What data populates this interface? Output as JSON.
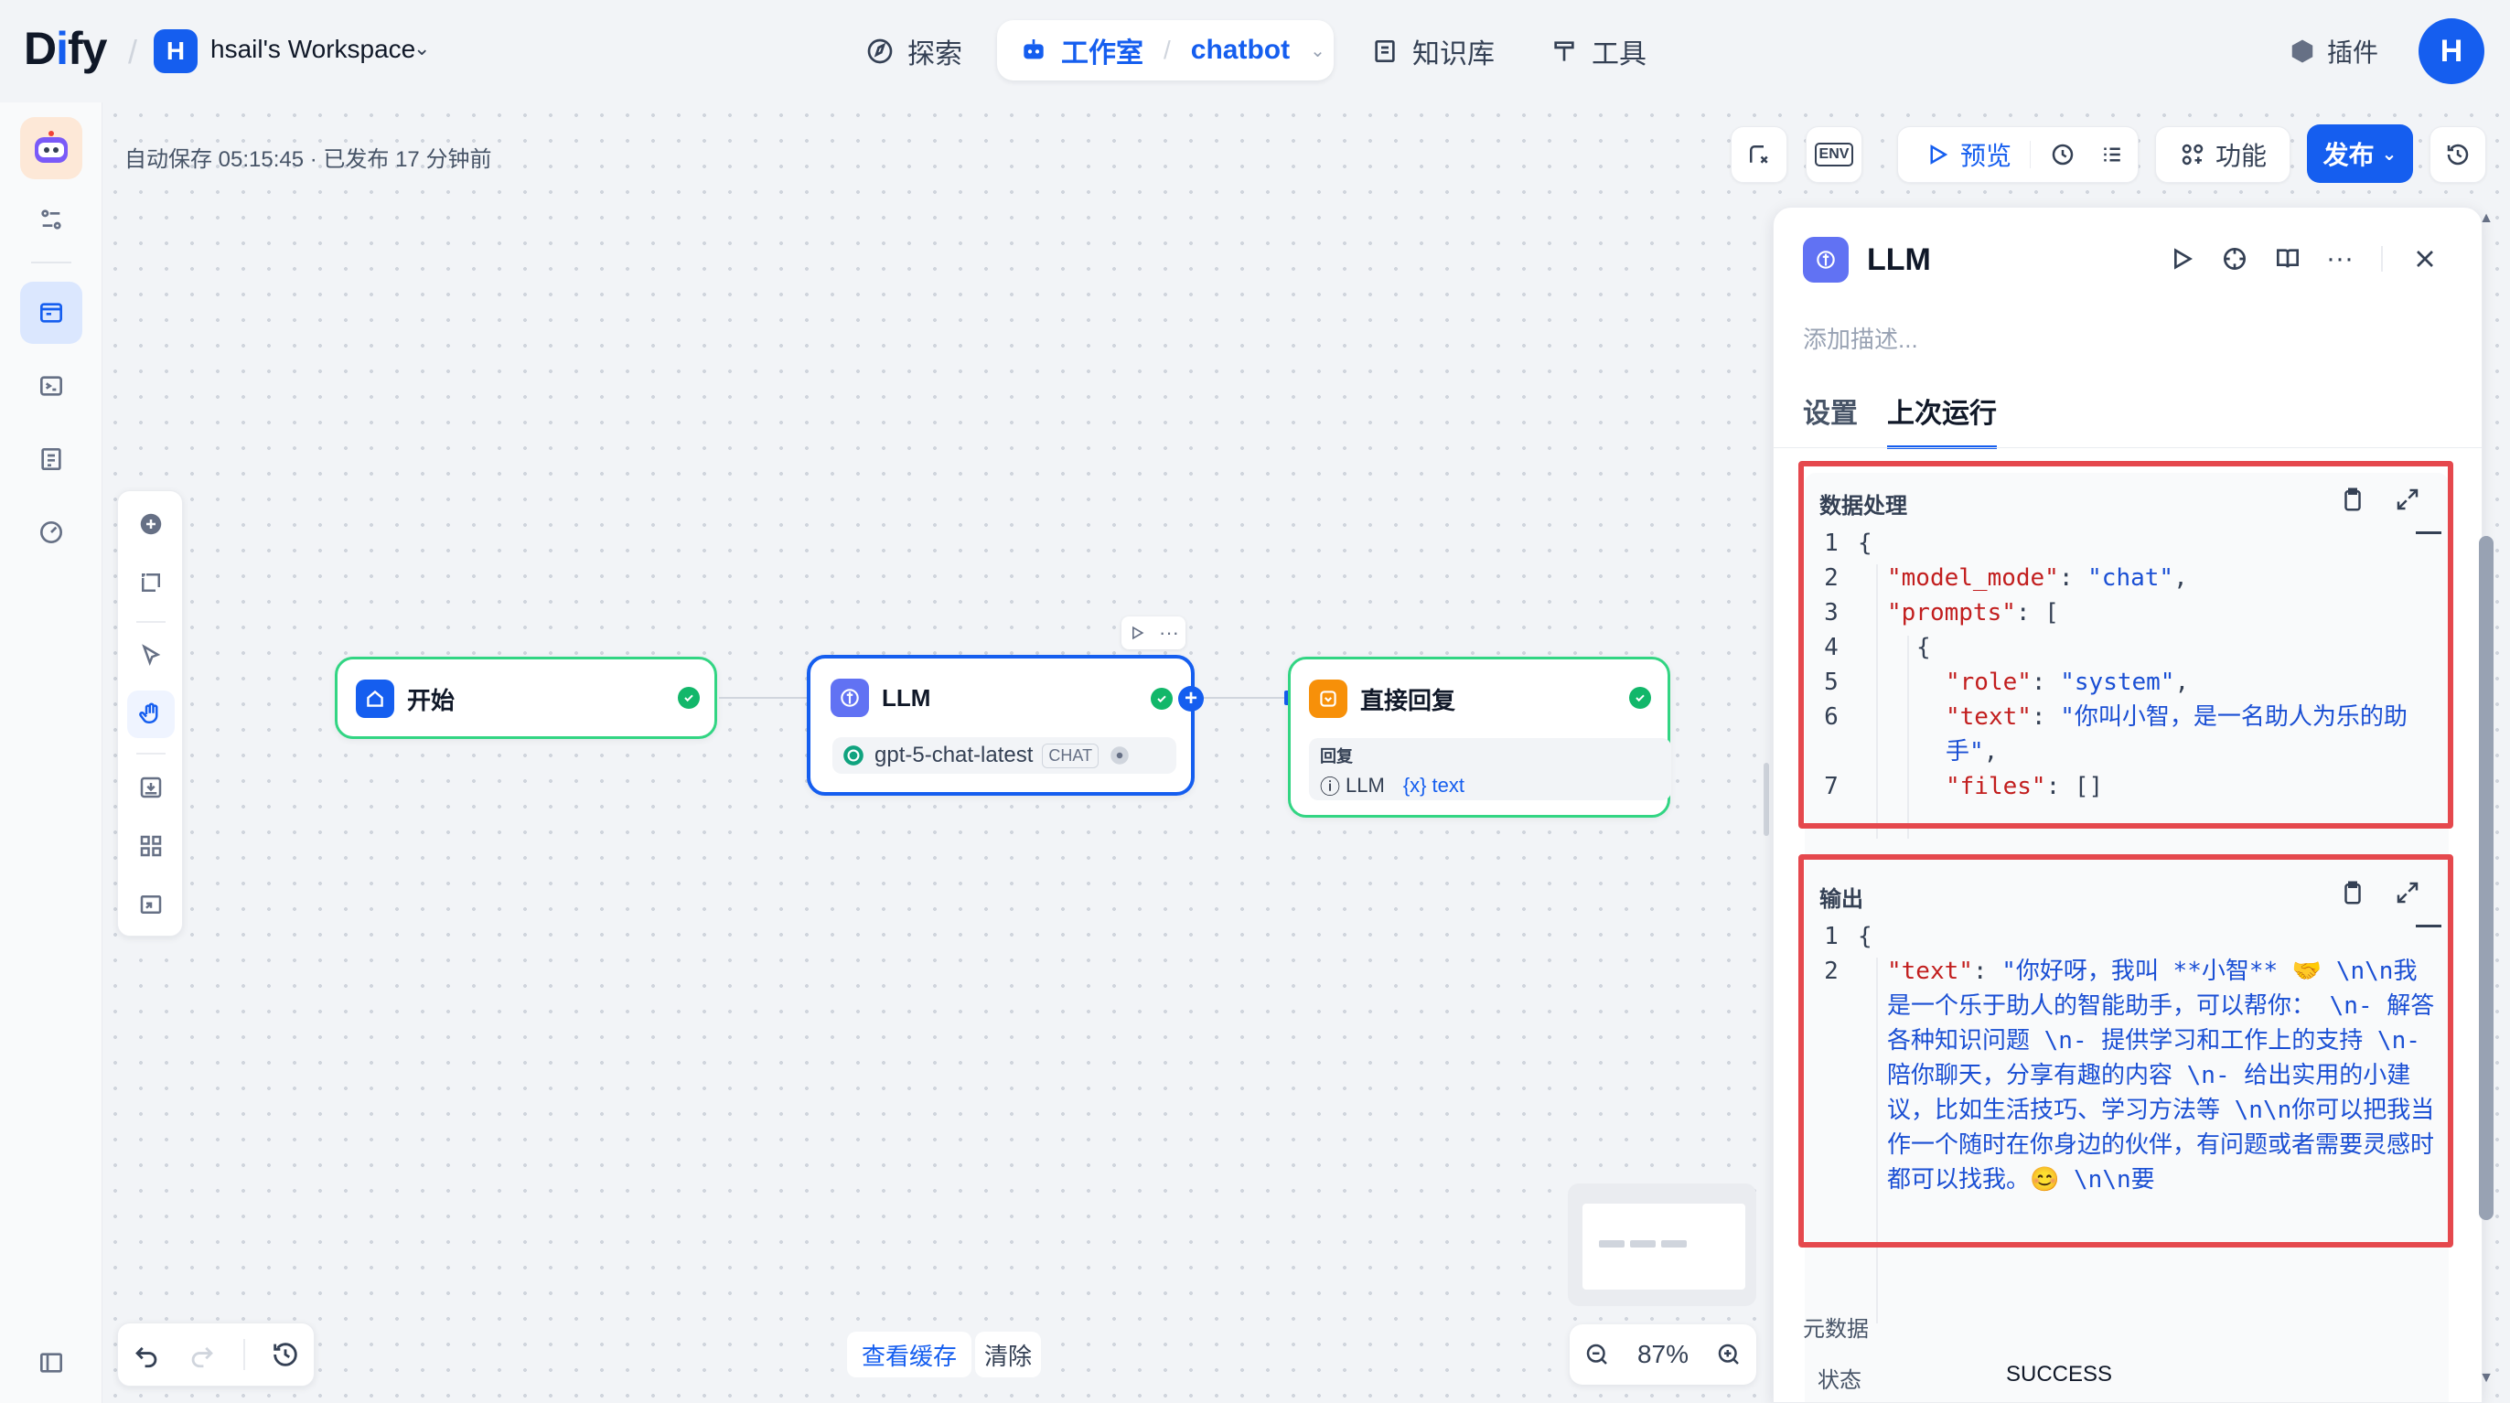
{
  "header": {
    "logo_d": "D",
    "logo_i": "i",
    "logo_fy": "fy",
    "workspace_initial": "H",
    "workspace_name": "hsail's Workspace",
    "nav": {
      "explore": "探索",
      "studio": "工作室",
      "app_name": "chatbot",
      "knowledge": "知识库",
      "tools": "工具"
    },
    "plugins": "插件",
    "user_initial": "H"
  },
  "toolbar": {
    "autosave_text": "自动保存 05:15:45 · 已发布 17 分钟前",
    "env_label": "ENV",
    "preview": "预览",
    "features": "功能",
    "publish": "发布"
  },
  "nodes": {
    "start": {
      "title": "开始"
    },
    "llm": {
      "title": "LLM",
      "model": "gpt-5-chat-latest",
      "mode_badge": "CHAT"
    },
    "reply": {
      "title": "直接回复",
      "section_label": "回复",
      "var_source": "LLM",
      "var_name": "text"
    }
  },
  "bottom": {
    "view_cache": "查看缓存",
    "clear": "清除",
    "zoom": "87%"
  },
  "panel": {
    "title": "LLM",
    "description_placeholder": "添加描述...",
    "tabs": {
      "settings": "设置",
      "last_run": "上次运行"
    },
    "data_processing": {
      "title": "数据处理",
      "lines": [
        {
          "n": "1",
          "indent": 0,
          "text": "{"
        },
        {
          "n": "2",
          "indent": 1,
          "key": "\"model_mode\"",
          "val": "\"chat\"",
          "tail": ","
        },
        {
          "n": "3",
          "indent": 1,
          "key": "\"prompts\"",
          "val": "[",
          "tail": ""
        },
        {
          "n": "4",
          "indent": 2,
          "text": "{"
        },
        {
          "n": "5",
          "indent": 3,
          "key": "\"role\"",
          "val": "\"system\"",
          "tail": ","
        },
        {
          "n": "6",
          "indent": 3,
          "key": "\"text\"",
          "val": "\"你叫小智，是一名助人为乐的助手\"",
          "tail": ","
        },
        {
          "n": "7",
          "indent": 3,
          "key": "\"files\"",
          "val": "[]",
          "tail": ""
        }
      ]
    },
    "output": {
      "title": "输出",
      "line1": "{",
      "key": "\"text\"",
      "value": "\"你好呀，我叫 **小智** 🤝 \\n\\n我是一个乐于助人的智能助手，可以帮你： \\n- 解答各种知识问题 \\n- 提供学习和工作上的支持 \\n- 陪你聊天，分享有趣的内容 \\n- 给出实用的小建议，比如生活技巧、学习方法等 \\n\\n你可以把我当作一个随时在你身边的伙伴，有问题或者需要灵感时都可以找我。😊 \\n\\n要"
    },
    "metadata": {
      "title": "元数据",
      "status_label": "状态",
      "status_value": "SUCCESS"
    }
  }
}
